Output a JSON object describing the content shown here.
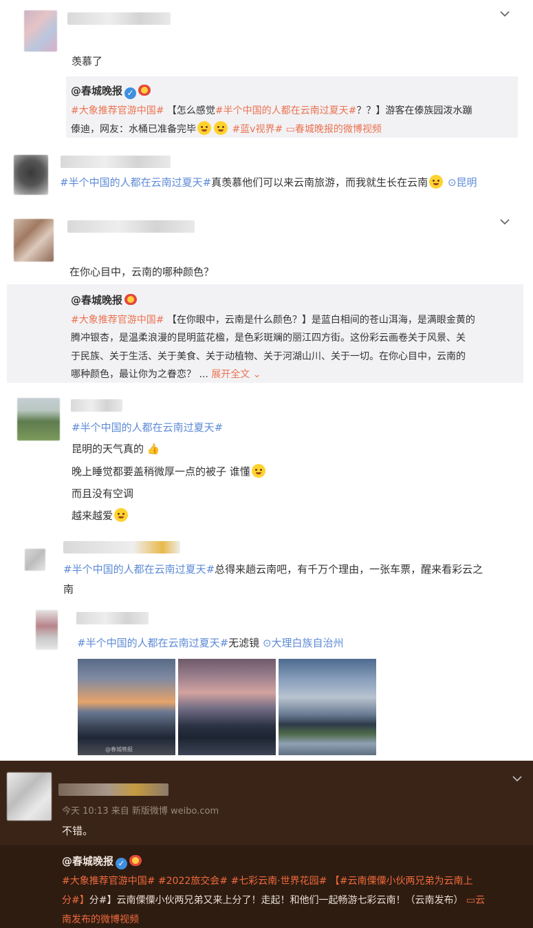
{
  "comments": {
    "c1": {
      "text": "羡慕了"
    },
    "c3": {
      "text": "在你心目中，云南的哪种颜色？"
    },
    "c4": {
      "topic": "#半个中国的人都在云南过夏天#",
      "line1": "昆明的天气真的",
      "line2": "晚上睡觉都要盖稍微厚一点的被子 谁懂",
      "line3": "而且没有空调",
      "line4": "越来越爱"
    },
    "c6": {
      "topic": "#半个中国的人都在云南过夏天#",
      "text": "无滤镜",
      "location": "大理白族自治州"
    },
    "c7": {
      "meta": "今天 10:13 来自 新版微博 weibo.com",
      "text": "不错。"
    }
  },
  "reply1": {
    "topic": "#半个中国的人都在云南过夏天#",
    "text": "真羡慕他们可以来云南旅游，而我就生长在云南",
    "location": "昆明"
  },
  "reply2": {
    "topic": "#半个中国的人都在云南过夏天#",
    "text1": "总得来趟云南吧，有千万个理由，一张车票，醒来看彩云之",
    "text2": "南"
  },
  "quote1": {
    "name": "@春城晚报",
    "topic1": "#大象推荐官游中国#",
    "text1a": "【怎么感觉",
    "topic2": "#半个中国的人都在云南过夏天#",
    "text1b": "？？】游客在傣族园泼水蹦",
    "text2": "傣迪，网友：水桶已准备完毕",
    "topic3": "#蓝v视界#",
    "video": "春城晚报的微博视频"
  },
  "quote2": {
    "name": "@春城晚报",
    "topic1": "#大象推荐官游中国#",
    "text1": "【在你眼中，云南是什么颜色？】是蓝白相间的苍山洱海，是满眼金黄的",
    "text2": "腾冲银杏，是温柔浪漫的昆明蓝花楹，是色彩斑斓的丽江四方街。这份彩云画卷关于风景、关",
    "text3": "于民族、关于生活、关于美食、关于动植物、关于河湖山川、关于一切。在你心目中，云南的",
    "text4": "哪种颜色，最让你为之眷恋？ ...",
    "expand": "展开全文"
  },
  "quote3": {
    "name": "@春城晚报",
    "line1": "#大象推荐官游中国# #2022旅交会# #七彩云南·世界花园# 【#云南傈僳小伙两兄弟为云南上",
    "line2a": "分#】云南傈僳小伙两兄弟又来上分了！走起！和他们一起畅游七彩云南！（云南发布）",
    "line2b": "云",
    "line3": "南发布的微博视频"
  },
  "photos": {
    "watermark": "@春城晚报"
  },
  "colors": {
    "topic": "#eb7350",
    "link": "#5d8ad6",
    "dark_bg": "#3a2417"
  },
  "icons": [
    "chevron-down-icon",
    "verified-icon",
    "crown-icon",
    "location-icon",
    "video-icon"
  ]
}
